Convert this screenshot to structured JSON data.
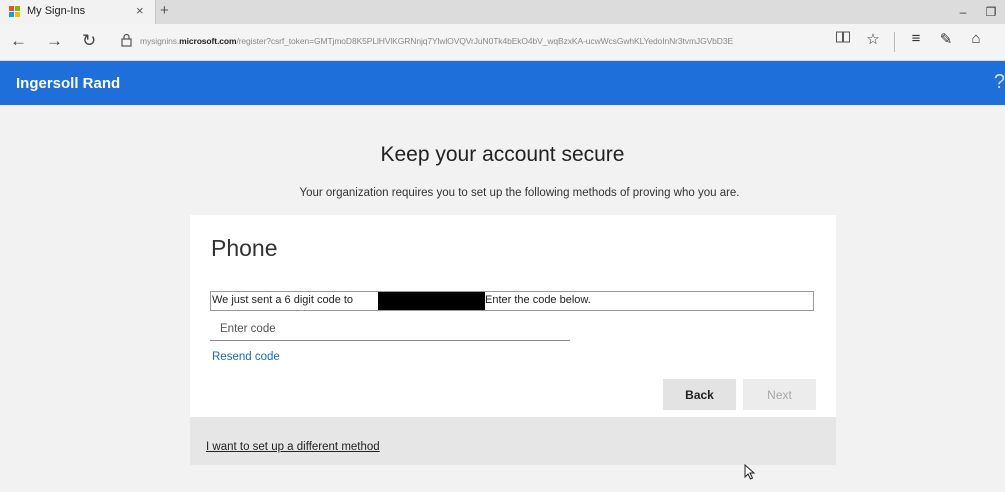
{
  "browser": {
    "tab_title": "My Sign-Ins",
    "tab_close": "×",
    "new_tab": "+",
    "minimize": "–",
    "restore": "❐",
    "url_prefix": "mysignins.",
    "url_domain": "microsoft.com",
    "url_rest": "/register?csrf_token=GMTjmoD8K5PLlHVlKGRNnjq7YlwlOVQVrJuN0Tk4bEkO4bV_wqBzxKA-ucwWcsGwhKLYedoInNr3tvmJGVbD3E",
    "back_icon": "←",
    "forward_icon": "→",
    "refresh_icon": "↻",
    "lock_icon": "🔒",
    "reading_icon": "▯▯",
    "favorite_icon": "☆",
    "hub_icon": "≡",
    "note_icon": "✎",
    "share_icon": "⌂",
    "more_icon": "·"
  },
  "header": {
    "org_name": "Ingersoll Rand",
    "help": "?"
  },
  "page": {
    "title": "Keep your account secure",
    "subtitle": "Your organization requires you to set up the following methods of proving who you are."
  },
  "card": {
    "heading": "Phone",
    "message_part1": "We just sent a 6 digit code to",
    "message_part2": "Enter the code below.",
    "code_input_placeholder": "Enter code",
    "code_input_value": "",
    "resend_label": "Resend code",
    "back_label": "Back",
    "next_label": "Next",
    "different_method_label": "I want to set up a different method"
  },
  "colors": {
    "header_bg": "#1e6fd9",
    "link": "#1569c7"
  }
}
